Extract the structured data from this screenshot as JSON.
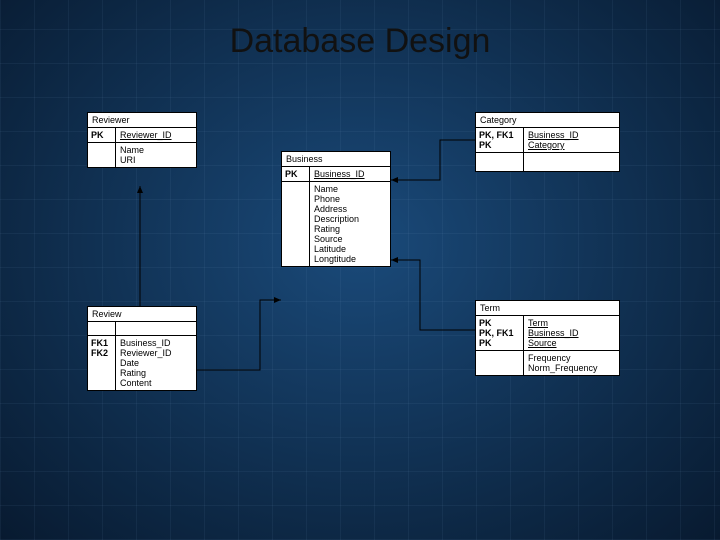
{
  "title": "Database Design",
  "entities": {
    "reviewer": {
      "name": "Reviewer",
      "pk_row": {
        "keys": "PK",
        "attrs": "Reviewer_ID"
      },
      "body": {
        "keys": "",
        "attrs": "Name\nURI"
      }
    },
    "business": {
      "name": "Business",
      "pk_row": {
        "keys": "PK",
        "attrs": "Business_ID"
      },
      "body": {
        "keys": "",
        "attrs": "Name\nPhone\nAddress\nDescription\nRating\nSource\nLatitude\nLongtitude"
      }
    },
    "category": {
      "name": "Category",
      "pk_row": {
        "keys": "PK, FK1\nPK",
        "attrs": "Business_ID\nCategory"
      },
      "body": {
        "keys": "",
        "attrs": ""
      }
    },
    "review": {
      "name": "Review",
      "pk_row": {
        "keys": "",
        "attrs": ""
      },
      "body": {
        "keys": "FK1\nFK2",
        "attrs": "Business_ID\nReviewer_ID\nDate\nRating\nContent"
      }
    },
    "term": {
      "name": "Term",
      "pk_row": {
        "keys": "PK\nPK, FK1\nPK",
        "attrs": "Term\nBusiness_ID\nSource"
      },
      "body": {
        "keys": "",
        "attrs": "Frequency\nNorm_Frequency"
      }
    }
  },
  "chart_data": {
    "type": "table",
    "description": "Entity-relationship diagram with 5 tables",
    "entities": [
      {
        "name": "Reviewer",
        "pk": [
          "Reviewer_ID"
        ],
        "attrs": [
          "Name",
          "URI"
        ]
      },
      {
        "name": "Business",
        "pk": [
          "Business_ID"
        ],
        "attrs": [
          "Name",
          "Phone",
          "Address",
          "Description",
          "Rating",
          "Source",
          "Latitude",
          "Longtitude"
        ]
      },
      {
        "name": "Category",
        "pk": [
          "Business_ID",
          "Category"
        ],
        "fk": [
          "Business_ID"
        ],
        "attrs": []
      },
      {
        "name": "Review",
        "pk": [],
        "fk": [
          "Business_ID",
          "Reviewer_ID"
        ],
        "attrs": [
          "Date",
          "Rating",
          "Content"
        ]
      },
      {
        "name": "Term",
        "pk": [
          "Term",
          "Business_ID",
          "Source"
        ],
        "fk": [
          "Business_ID"
        ],
        "attrs": [
          "Frequency",
          "Norm_Frequency"
        ]
      }
    ],
    "relationships": [
      {
        "from": "Review.Reviewer_ID",
        "to": "Reviewer.Reviewer_ID"
      },
      {
        "from": "Review.Business_ID",
        "to": "Business.Business_ID"
      },
      {
        "from": "Category.Business_ID",
        "to": "Business.Business_ID"
      },
      {
        "from": "Term.Business_ID",
        "to": "Business.Business_ID"
      }
    ]
  }
}
